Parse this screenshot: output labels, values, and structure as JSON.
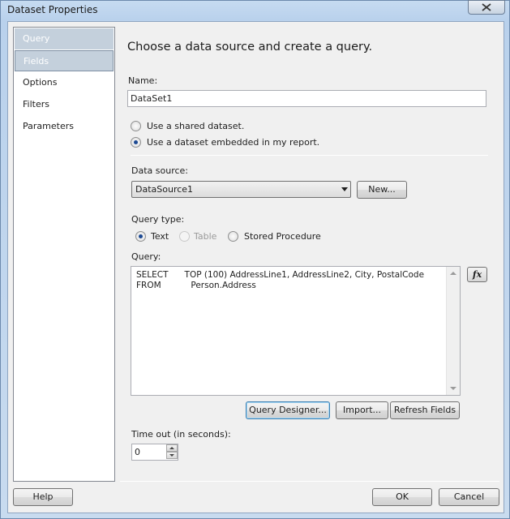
{
  "window": {
    "title": "Dataset Properties",
    "close_icon": "close-icon"
  },
  "nav": {
    "items": [
      {
        "label": "Query",
        "state": "selected"
      },
      {
        "label": "Fields",
        "state": "hover"
      },
      {
        "label": "Options",
        "state": "normal"
      },
      {
        "label": "Filters",
        "state": "normal"
      },
      {
        "label": "Parameters",
        "state": "normal"
      }
    ]
  },
  "main": {
    "heading": "Choose a data source and create a query.",
    "name_label": "Name:",
    "name_value": "DataSet1",
    "radio_shared_label": "Use a shared dataset.",
    "radio_shared_checked": false,
    "radio_embedded_label": "Use a dataset embedded in my report.",
    "radio_embedded_checked": true,
    "datasource_label": "Data source:",
    "datasource_value": "DataSource1",
    "new_button": "New...",
    "querytype_label": "Query type:",
    "querytype_options": [
      {
        "label": "Text",
        "checked": true,
        "enabled": true
      },
      {
        "label": "Table",
        "checked": false,
        "enabled": false
      },
      {
        "label": "Stored Procedure",
        "checked": false,
        "enabled": true
      }
    ],
    "query_label": "Query:",
    "query_lines": [
      "SELECT      TOP (100) AddressLine1, AddressLine2, City, PostalCode",
      "FROM           Person.Address"
    ],
    "fx_button": "fx",
    "query_designer_button": "Query Designer...",
    "import_button": "Import...",
    "refresh_fields_button": "Refresh Fields",
    "timeout_label": "Time out (in seconds):",
    "timeout_value": "0"
  },
  "footer": {
    "help_button": "Help",
    "ok_button": "OK",
    "cancel_button": "Cancel"
  }
}
